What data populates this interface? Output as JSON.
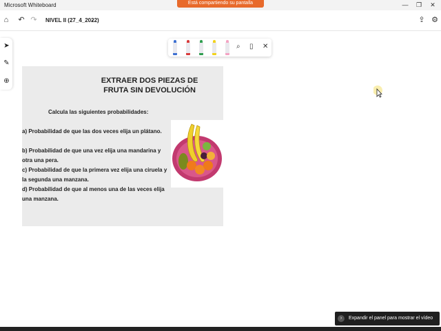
{
  "window": {
    "title": "Microsoft Whiteboard",
    "minimize": "—",
    "restore": "❐",
    "close": "✕"
  },
  "share_banner": "Está compartiendo su pantalla",
  "toolbar": {
    "home_icon": "⌂",
    "undo_icon": "↶",
    "redo_icon": "↷",
    "board_name": "NIVEL II (27_4_2022)",
    "chevron": "⌄",
    "share_icon": "⇪",
    "settings_icon": "⚙"
  },
  "left_rail": {
    "select_icon": "➤",
    "pen_icon": "✎",
    "add_icon": "⊕"
  },
  "pen_bar": {
    "pens": [
      {
        "name": "blue",
        "color": "#3c6fd1"
      },
      {
        "name": "red",
        "color": "#d83a3a"
      },
      {
        "name": "green",
        "color": "#2f9e4f"
      },
      {
        "name": "yellow",
        "color": "#f2d21b"
      },
      {
        "name": "pink",
        "color": "#f3a3c3"
      }
    ],
    "lasso_icon": "⌕",
    "ruler_icon": "▯",
    "close_icon": "✕"
  },
  "card": {
    "title_line1": "EXTRAER DOS PIEZAS DE",
    "title_line2": "FRUTA SIN DEVOLUCIÓN",
    "subtitle": "Calcula las siguientes probabilidades:",
    "questions": [
      "a) Probabilidad de que las dos veces elija un plátano.",
      "b) Probabilidad de que una vez elija una mandarina y otra una pera.",
      "c) Probabilidad de que la primera vez elija una ciruela y la segunda una manzana.",
      "d) Probabilidad de que al menos una de las veces elija una manzana."
    ]
  },
  "notice": {
    "arrow": "›",
    "text": "Expandir el panel para mostrar el vídeo"
  }
}
